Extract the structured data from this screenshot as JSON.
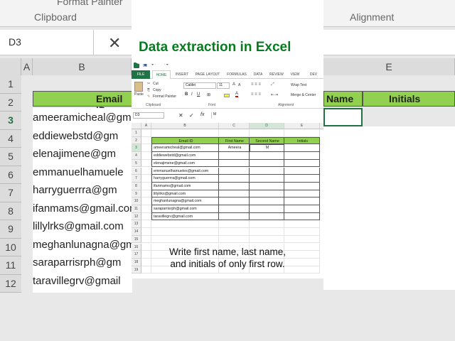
{
  "background": {
    "ribbon_group_1": "Clipboard",
    "ribbon_group_2": "Alignment",
    "ribbon_partial_item": "Format Painter",
    "name_box": "D3",
    "col_headers": [
      "A",
      "B",
      "E"
    ],
    "row_numbers": [
      "1",
      "2",
      "3",
      "4",
      "5",
      "6",
      "7",
      "8",
      "9",
      "10",
      "11",
      "12"
    ],
    "header_email": "Email ID",
    "header_name_partial": "Name",
    "header_initials": "Initials",
    "emails": [
      "ameeramicheal@gm",
      "eddiewebstd@gm",
      "elenajimene@gm",
      "emmanuelhamuele",
      "harryguerrra@gm",
      "ifanmams@gmail.com",
      "lillylrks@gmail.com",
      "meghanlunagna@gm",
      "saraparrisrph@gm",
      "taravillegrv@gmail"
    ]
  },
  "title": "Data extraction in Excel",
  "ribbon": {
    "tabs": [
      "FILE",
      "HOME",
      "INSERT",
      "PAGE LAYOUT",
      "FORMULAS",
      "DATA",
      "REVIEW",
      "VIEW",
      "DEV"
    ],
    "cut": "Cut",
    "copy": "Copy",
    "format_painter": "Format Painter",
    "paste": "Paste",
    "font_name": "Calibri",
    "font_size": "11",
    "wrap_text": "Wrap Text",
    "merge_center": "Merge & Center",
    "group_clipboard": "Clipboard",
    "group_font": "Font",
    "group_alignment": "Alignment"
  },
  "formula_bar": {
    "name_box": "D3",
    "fx": "fx",
    "value": "M"
  },
  "sheet": {
    "columns": [
      "A",
      "B",
      "C",
      "D",
      "E"
    ],
    "rows": [
      "1",
      "2",
      "3",
      "4",
      "5",
      "6",
      "7",
      "8",
      "9",
      "10",
      "11",
      "12",
      "13",
      "14",
      "15",
      "16",
      "17",
      "18",
      "19"
    ],
    "headers": [
      "Email ID",
      "First Name",
      "Second Name",
      "Initials"
    ],
    "emails": [
      "ameeramicheal@gmail.com",
      "eddiewebstd@gmail.com",
      "elenajimene@gmail.com",
      "emmanuelhamueles@gmail.com",
      "harryguerrra@gmail.com",
      "ifanmams@gmail.com",
      "lillylrks@gmail.com",
      "meghanlunagna@gmail.com",
      "saraparrisrph@gmail.com",
      "taravillegrv@gmail.com"
    ],
    "first_name_row3": "Ameera",
    "second_name_row3": "M"
  },
  "caption": {
    "line1": "Write first name, last name,",
    "line2": "and initials of only first row."
  }
}
